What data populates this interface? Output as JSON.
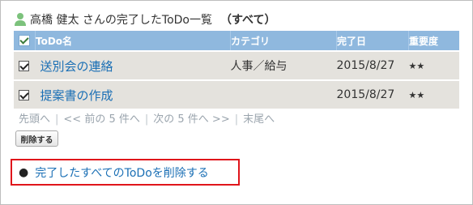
{
  "title": {
    "text": "高橋 健太 さんの完了したToDo一覧",
    "filter": "（すべて）"
  },
  "table": {
    "headers": [
      "ToDo名",
      "カテゴリ",
      "完了日",
      "重要度"
    ],
    "rows": [
      {
        "name": "送別会の連絡",
        "category": "人事／給与",
        "date": "2015/8/27",
        "priority": "★★",
        "checked": true
      },
      {
        "name": "提案書の作成",
        "category": "",
        "date": "2015/8/27",
        "priority": "★★",
        "checked": true
      }
    ]
  },
  "pager": {
    "first": "先頭へ",
    "prev": "<< 前の 5 件へ",
    "next": "次の 5 件へ >>",
    "last": "末尾へ",
    "separator": "|"
  },
  "delete_button": "削除する",
  "delete_all_link": "完了したすべてのToDoを削除する",
  "colors": {
    "header_bg": "#8fb8de",
    "row_bg": "#e4e2dd",
    "link": "#1a6fb5",
    "highlight": "#e0151b"
  },
  "icons": {
    "user": "user-icon",
    "header_check": "checkbox-icon"
  }
}
